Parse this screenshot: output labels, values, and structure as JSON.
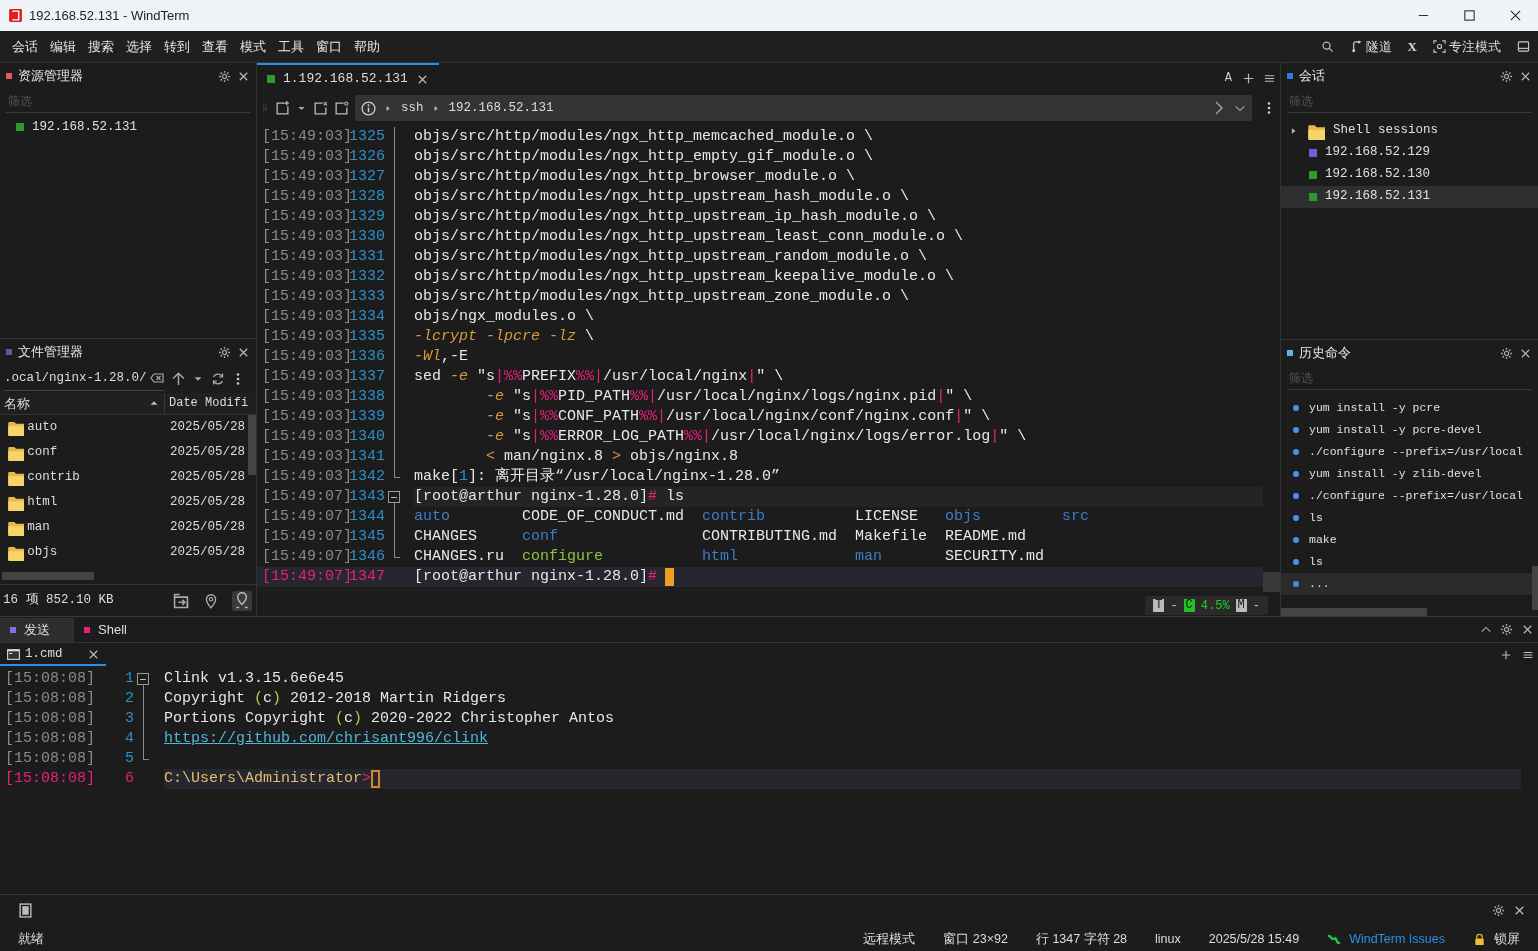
{
  "window": {
    "title": "192.168.52.131 - WindTerm"
  },
  "menu": [
    "会话",
    "编辑",
    "搜索",
    "选择",
    "转到",
    "查看",
    "模式",
    "工具",
    "窗口",
    "帮助"
  ],
  "toolbar": [
    {
      "kind": "search"
    },
    {
      "kind": "tunnel",
      "label": "隧道"
    },
    {
      "kind": "text",
      "label": "X"
    },
    {
      "kind": "focus",
      "label": "专注模式"
    },
    {
      "kind": "layout"
    }
  ],
  "explorer": {
    "title": "资源管理器",
    "color": "#e05a6a",
    "filter": {
      "placeholder": "筛选"
    },
    "items": [
      {
        "label": "192.168.52.131",
        "color": "#2e9a2e"
      }
    ]
  },
  "file_manager": {
    "title": "文件管理器",
    "color": "#5a5aa8",
    "path": ".ocal/nginx-1.28.0/",
    "columns": [
      "名称",
      "Date Modifi"
    ],
    "rows": [
      {
        "name": "auto",
        "date": "2025/05/28"
      },
      {
        "name": "conf",
        "date": "2025/05/28"
      },
      {
        "name": "contrib",
        "date": "2025/05/28"
      },
      {
        "name": "html",
        "date": "2025/05/28"
      },
      {
        "name": "man",
        "date": "2025/05/28"
      },
      {
        "name": "objs",
        "date": "2025/05/28"
      }
    ],
    "summary": "16 项 852.10 KB"
  },
  "session_tabs": [
    {
      "label": "1.192.168.52.131",
      "color": "#2e9a2e",
      "selected": true
    }
  ],
  "tab_tools": {
    "font_label": "A"
  },
  "address": {
    "protocol": "ssh",
    "host": "192.168.52.131"
  },
  "terminal": {
    "lines": [
      {
        "time": "[15:49:03]",
        "number": "1325",
        "fold": {
          "kind": "line"
        },
        "segments": [
          {
            "kind": "plain",
            "text": "objs/src/http/modules/ngx_http_memcached_module.o \\"
          }
        ]
      },
      {
        "time": "[15:49:03]",
        "number": "1326",
        "fold": {
          "kind": "line"
        },
        "segments": [
          {
            "kind": "plain",
            "text": "objs/src/http/modules/ngx_http_empty_gif_module.o \\"
          }
        ]
      },
      {
        "time": "[15:49:03]",
        "number": "1327",
        "fold": {
          "kind": "line"
        },
        "segments": [
          {
            "kind": "plain",
            "text": "objs/src/http/modules/ngx_http_browser_module.o \\"
          }
        ]
      },
      {
        "time": "[15:49:03]",
        "number": "1328",
        "fold": {
          "kind": "line"
        },
        "segments": [
          {
            "kind": "plain",
            "text": "objs/src/http/modules/ngx_http_upstream_hash_module.o \\"
          }
        ]
      },
      {
        "time": "[15:49:03]",
        "number": "1329",
        "fold": {
          "kind": "line"
        },
        "segments": [
          {
            "kind": "plain",
            "text": "objs/src/http/modules/ngx_http_upstream_ip_hash_module.o \\"
          }
        ]
      },
      {
        "time": "[15:49:03]",
        "number": "1330",
        "fold": {
          "kind": "line"
        },
        "segments": [
          {
            "kind": "plain",
            "text": "objs/src/http/modules/ngx_http_upstream_least_conn_module.o \\"
          }
        ]
      },
      {
        "time": "[15:49:03]",
        "number": "1331",
        "fold": {
          "kind": "line"
        },
        "segments": [
          {
            "kind": "plain",
            "text": "objs/src/http/modules/ngx_http_upstream_random_module.o \\"
          }
        ]
      },
      {
        "time": "[15:49:03]",
        "number": "1332",
        "fold": {
          "kind": "line"
        },
        "segments": [
          {
            "kind": "plain",
            "text": "objs/src/http/modules/ngx_http_upstream_keepalive_module.o \\"
          }
        ]
      },
      {
        "time": "[15:49:03]",
        "number": "1333",
        "fold": {
          "kind": "line"
        },
        "segments": [
          {
            "kind": "plain",
            "text": "objs/src/http/modules/ngx_http_upstream_zone_module.o \\"
          }
        ]
      },
      {
        "time": "[15:49:03]",
        "number": "1334",
        "fold": {
          "kind": "line"
        },
        "segments": [
          {
            "kind": "plain",
            "text": "objs/ngx_modules.o \\"
          }
        ]
      },
      {
        "time": "[15:49:03]",
        "number": "1335",
        "fold": {
          "kind": "line"
        },
        "segments": [
          {
            "kind": "option",
            "text": "-lcrypt -lpcre -lz"
          },
          {
            "kind": "plain",
            "text": " \\"
          }
        ]
      },
      {
        "time": "[15:49:03]",
        "number": "1336",
        "fold": {
          "kind": "line"
        },
        "segments": [
          {
            "kind": "option",
            "text": "-Wl"
          },
          {
            "kind": "plain",
            "text": ",-E"
          }
        ]
      },
      {
        "time": "[15:49:03]",
        "number": "1337",
        "fold": {
          "kind": "line"
        },
        "segments": [
          {
            "kind": "plain",
            "text": "sed "
          },
          {
            "kind": "option",
            "text": "-e"
          },
          {
            "kind": "plain",
            "text": " \"s"
          },
          {
            "kind": "symbol",
            "text": "|%%"
          },
          {
            "kind": "plain",
            "text": "PREFIX"
          },
          {
            "kind": "symbol",
            "text": "%%|"
          },
          {
            "kind": "plain",
            "text": "/usr/local/nginx"
          },
          {
            "kind": "symbol",
            "text": "|"
          },
          {
            "kind": "plain",
            "text": "\" \\"
          }
        ]
      },
      {
        "time": "[15:49:03]",
        "number": "1338",
        "fold": {
          "kind": "line"
        },
        "indented": true,
        "segments": [
          {
            "kind": "option",
            "text": "-e"
          },
          {
            "kind": "plain",
            "text": " \"s"
          },
          {
            "kind": "symbol",
            "text": "|%%"
          },
          {
            "kind": "plain",
            "text": "PID_PATH"
          },
          {
            "kind": "symbol",
            "text": "%%|"
          },
          {
            "kind": "plain",
            "text": "/usr/local/nginx/logs/nginx.pid"
          },
          {
            "kind": "symbol",
            "text": "|"
          },
          {
            "kind": "plain",
            "text": "\" \\"
          }
        ]
      },
      {
        "time": "[15:49:03]",
        "number": "1339",
        "fold": {
          "kind": "line"
        },
        "indented": true,
        "segments": [
          {
            "kind": "option",
            "text": "-e"
          },
          {
            "kind": "plain",
            "text": " \"s"
          },
          {
            "kind": "symbol",
            "text": "|%%"
          },
          {
            "kind": "plain",
            "text": "CONF_PATH"
          },
          {
            "kind": "symbol",
            "text": "%%|"
          },
          {
            "kind": "plain",
            "text": "/usr/local/nginx/conf/nginx.conf"
          },
          {
            "kind": "symbol",
            "text": "|"
          },
          {
            "kind": "plain",
            "text": "\" \\"
          }
        ]
      },
      {
        "time": "[15:49:03]",
        "number": "1340",
        "fold": {
          "kind": "line"
        },
        "indented": true,
        "segments": [
          {
            "kind": "option",
            "text": "-e"
          },
          {
            "kind": "plain",
            "text": " \"s"
          },
          {
            "kind": "symbol",
            "text": "|%%"
          },
          {
            "kind": "plain",
            "text": "ERROR_LOG_PATH"
          },
          {
            "kind": "symbol",
            "text": "%%|"
          },
          {
            "kind": "plain",
            "text": "/usr/local/nginx/logs/error.log"
          },
          {
            "kind": "symbol",
            "text": "|"
          },
          {
            "kind": "plain",
            "text": "\" \\"
          }
        ]
      },
      {
        "time": "[15:49:03]",
        "number": "1341",
        "fold": {
          "kind": "line"
        },
        "indented": true,
        "segments": [
          {
            "kind": "option",
            "text": "<"
          },
          {
            "kind": "plain",
            "text": " man/nginx.8 "
          },
          {
            "kind": "option",
            "text": ">"
          },
          {
            "kind": "plain",
            "text": " objs/nginx.8"
          }
        ]
      },
      {
        "time": "[15:49:03]",
        "number": "1342",
        "fold": {
          "kind": "end"
        },
        "segments": [
          {
            "kind": "plain",
            "text": "make["
          },
          {
            "kind": "number",
            "text": "1"
          },
          {
            "kind": "plain",
            "text": "]: 离开目录“/usr/local/nginx-1.28.0”"
          }
        ]
      },
      {
        "time": "[15:49:07]",
        "number": "1343",
        "fold": {
          "kind": "start"
        },
        "marked": true,
        "segments": [
          {
            "kind": "plain",
            "text": "[root@arthur nginx-1.28.0]"
          },
          {
            "kind": "symbol",
            "text": "#"
          },
          {
            "kind": "plain",
            "text": " ls"
          }
        ]
      },
      {
        "time": "[15:49:07]",
        "number": "1344",
        "fold": {
          "kind": "line"
        },
        "columns": [
          {
            "kind": "dir",
            "text": "auto"
          },
          {
            "kind": "file",
            "text": "CODE_OF_CONDUCT.md"
          },
          {
            "kind": "dir",
            "text": "contrib"
          },
          {
            "kind": "file",
            "text": "LICENSE"
          },
          {
            "kind": "dir",
            "text": "objs"
          },
          {
            "kind": "dir",
            "text": "src"
          }
        ]
      },
      {
        "time": "[15:49:07]",
        "number": "1345",
        "fold": {
          "kind": "line"
        },
        "columns": [
          {
            "kind": "file",
            "text": "CHANGES"
          },
          {
            "kind": "dir",
            "text": "conf"
          },
          {
            "kind": "file",
            "text": "CONTRIBUTING.md"
          },
          {
            "kind": "file",
            "text": "Makefile"
          },
          {
            "kind": "file",
            "text": "README.md"
          }
        ]
      },
      {
        "time": "[15:49:07]",
        "number": "1346",
        "fold": {
          "kind": "end"
        },
        "columns": [
          {
            "kind": "file",
            "text": "CHANGES.ru"
          },
          {
            "kind": "exec",
            "text": "configure"
          },
          {
            "kind": "dir",
            "text": "html"
          },
          {
            "kind": "dir",
            "text": "man"
          },
          {
            "kind": "file",
            "text": "SECURITY.md"
          }
        ]
      },
      {
        "time": "[15:49:07]",
        "number": "1347",
        "current": true,
        "cursor": {
          "kind": "block"
        },
        "segments": [
          {
            "kind": "plain",
            "text": "[root@arthur nginx-1.28.0]"
          },
          {
            "kind": "symbol",
            "text": "#"
          }
        ]
      }
    ],
    "meter": [
      {
        "kind": "key",
        "text": "T"
      },
      {
        "kind": "plain",
        "text": "-"
      },
      {
        "kind": "key_on",
        "text": "C"
      },
      {
        "kind": "value",
        "text": "4.5%"
      },
      {
        "kind": "key",
        "text": "M"
      },
      {
        "kind": "plain",
        "text": "-"
      }
    ]
  },
  "sessions": {
    "title": "会话",
    "color": "#2a7ae0",
    "filter": {
      "placeholder": "筛选"
    },
    "items": [
      {
        "kind": "folder",
        "label": "Shell sessions",
        "selected": false
      },
      {
        "kind": "session",
        "label": "192.168.52.129",
        "color": "#7a5ad8",
        "selected": false
      },
      {
        "kind": "session",
        "label": "192.168.52.130",
        "color": "#2e9a2e",
        "selected": false
      },
      {
        "kind": "session",
        "label": "192.168.52.131",
        "color": "#2e9a2e",
        "selected": true
      }
    ]
  },
  "history": {
    "title": "历史命令",
    "color": "#5ab8e8",
    "filter": {
      "placeholder": "筛选"
    },
    "items": [
      {
        "text": "yum install -y pcre",
        "selected": false
      },
      {
        "text": "yum install -y pcre-devel",
        "selected": false
      },
      {
        "text": "./configure --prefix=/usr/local",
        "selected": false
      },
      {
        "text": "yum install -y zlib-devel",
        "selected": false
      },
      {
        "text": "./configure --prefix=/usr/local",
        "selected": false
      },
      {
        "text": "ls",
        "selected": false
      },
      {
        "text": "make",
        "selected": false
      },
      {
        "text": "ls",
        "selected": false
      },
      {
        "text": "...",
        "selected": true
      }
    ]
  },
  "bottom_panel": {
    "tabs": [
      {
        "label": "发送",
        "color": "#8a6ee0",
        "selected": true
      },
      {
        "label": "Shell",
        "color": "#e8207a",
        "selected": false
      }
    ],
    "console_tabs": [
      {
        "label": "1.cmd",
        "selected": true
      }
    ],
    "lines": [
      {
        "time": "[15:08:08]",
        "number": "1",
        "fold": {
          "kind": "start"
        },
        "segments": [
          {
            "kind": "plain",
            "text": "Clink v1.3.15.6e6e45"
          }
        ]
      },
      {
        "time": "[15:08:08]",
        "number": "2",
        "fold": {
          "kind": "line"
        },
        "segments": [
          {
            "kind": "plain",
            "text": "Copyright "
          },
          {
            "kind": "paren",
            "text": "("
          },
          {
            "kind": "plain",
            "text": "c"
          },
          {
            "kind": "paren",
            "text": ")"
          },
          {
            "kind": "plain",
            "text": " 2012-2018 Martin Ridgers"
          }
        ]
      },
      {
        "time": "[15:08:08]",
        "number": "3",
        "fold": {
          "kind": "line"
        },
        "segments": [
          {
            "kind": "plain",
            "text": "Portions Copyright "
          },
          {
            "kind": "paren",
            "text": "("
          },
          {
            "kind": "plain",
            "text": "c"
          },
          {
            "kind": "paren",
            "text": ")"
          },
          {
            "kind": "plain",
            "text": " 2020-2022 Christopher Antos"
          }
        ]
      },
      {
        "time": "[15:08:08]",
        "number": "4",
        "fold": {
          "kind": "line"
        },
        "segments": [
          {
            "kind": "link",
            "text": "https://github.com/chrisant996/clink"
          }
        ]
      },
      {
        "time": "[15:08:08]",
        "number": "5",
        "fold": {
          "kind": "end"
        }
      },
      {
        "time": "[15:08:08]",
        "number": "6",
        "current": true,
        "cursor": {
          "kind": "outline"
        },
        "segments": [
          {
            "kind": "path",
            "text": "C:\\Users\\Administrator"
          },
          {
            "kind": "symbol",
            "text": ">"
          }
        ]
      }
    ]
  },
  "status_bar": {
    "left": "就绪",
    "items": [
      {
        "kind": "text",
        "text": "远程模式"
      },
      {
        "kind": "text",
        "text": "窗口 23×92"
      },
      {
        "kind": "text",
        "text": "行 1347 字符 28"
      },
      {
        "kind": "text",
        "text": "linux"
      },
      {
        "kind": "text",
        "text": "2025/5/28 15:49"
      },
      {
        "kind": "link",
        "text": "WindTerm Issues"
      },
      {
        "kind": "lock",
        "text": "锁屏"
      }
    ]
  }
}
